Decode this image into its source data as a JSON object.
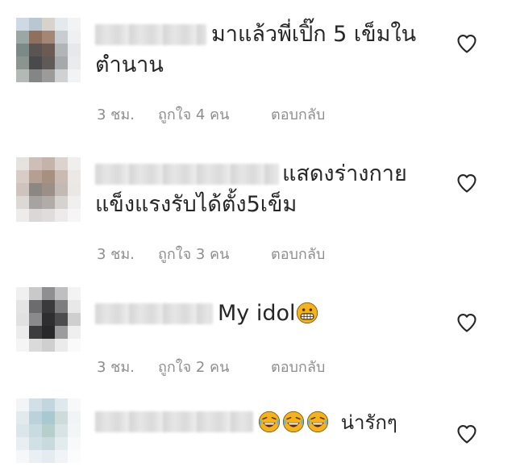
{
  "comments": [
    {
      "text_line1": "มาแล้วพี่เปิ๊ก 5 เข็มใน",
      "text_line2": "ตำนาน",
      "time": "3 ชม.",
      "likes": "ถูกใจ 4 คน",
      "reply": "ตอบกลับ"
    },
    {
      "text_line1": "แสดงร่างกาย",
      "text_line2": "แข็งแรงรับได้ตั้ง5เข็ม",
      "time": "3 ชม.",
      "likes": "ถูกใจ 3 คน",
      "reply": "ตอบกลับ"
    },
    {
      "text_line1": "My idol",
      "time": "3 ชม.",
      "likes": "ถูกใจ 2 คน",
      "reply": "ตอบกลับ"
    },
    {
      "text_line1": "น่ารักๆ"
    }
  ],
  "icons": {
    "like": "heart-outline-icon",
    "emoji_grin": "grimacing-face-emoji",
    "emoji_laugh": "tears-of-joy-emoji"
  },
  "colors": {
    "text": "#262626",
    "meta": "#8e8e8e",
    "emoji": "#f5b21b"
  }
}
